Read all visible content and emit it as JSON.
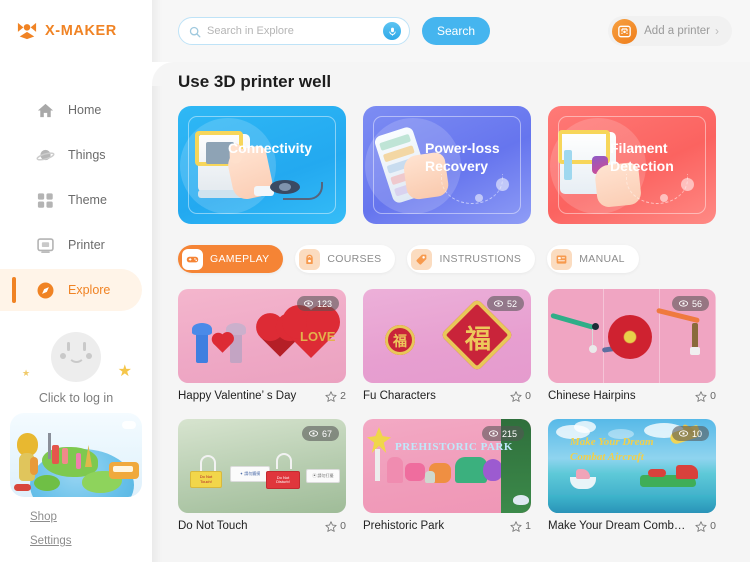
{
  "brand": {
    "name": "X-MAKER",
    "logo_icon": "x-maker-logo-icon",
    "color": "#f08324"
  },
  "search": {
    "placeholder": "Search in Explore",
    "value": "",
    "search_icon": "search-icon",
    "mic_icon": "microphone-icon",
    "button_label": "Search"
  },
  "add_printer": {
    "label": "Add a printer",
    "icon": "printer-add-icon",
    "chevron": "›"
  },
  "sidebar": {
    "items": [
      {
        "label": "Home",
        "icon": "home-icon",
        "active": false
      },
      {
        "label": "Things",
        "icon": "planet-icon",
        "active": false
      },
      {
        "label": "Theme",
        "icon": "grid-icon",
        "active": false
      },
      {
        "label": "Printer",
        "icon": "printer-icon",
        "active": false
      },
      {
        "label": "Explore",
        "icon": "compass-icon",
        "active": true
      }
    ],
    "login": {
      "text": "Click to log in",
      "avatar_icon": "smiley-avatar-icon"
    },
    "links": [
      {
        "label": "Shop"
      },
      {
        "label": "Settings"
      }
    ]
  },
  "main": {
    "title": "Use 3D printer well",
    "banners": [
      {
        "title": "Connectivity",
        "color": "#23a9f0"
      },
      {
        "title": "Power-loss\nRecovery",
        "color": "#6675ee"
      },
      {
        "title": "Filament Detection",
        "color": "#fb6360"
      }
    ],
    "banner_titles": {
      "b1": "Connectivity",
      "b2_line1": "Power-loss",
      "b2_line2": "Recovery",
      "b3": "Filament Detection"
    },
    "tabs": [
      {
        "label": "GAMEPLAY",
        "icon": "gamepad-icon",
        "active": true
      },
      {
        "label": "COURSES",
        "icon": "backpack-icon",
        "active": false
      },
      {
        "label": "INSTRUSTIONS",
        "icon": "tag-icon",
        "active": false
      },
      {
        "label": "MANUAL",
        "icon": "document-icon",
        "active": false
      }
    ],
    "cards": [
      {
        "title": "Happy Valentine’ s Day",
        "views": "123",
        "favorites": "2"
      },
      {
        "title": "Fu Characters",
        "views": "52",
        "favorites": "0"
      },
      {
        "title": "Chinese Hairpins",
        "views": "56",
        "favorites": "0"
      },
      {
        "title": "Do Not Touch",
        "views": "67",
        "favorites": "0"
      },
      {
        "title": "Prehistoric Park",
        "views": "215",
        "favorites": "1"
      },
      {
        "title": "Make Your Dream Combat A...",
        "views": "10",
        "favorites": "0"
      }
    ],
    "card_art": {
      "fu_char": "福",
      "valentine_word": "LOVE",
      "prehistoric_word": "PREHISTORIC PARK",
      "aircraft_line1": "Make Your Dream",
      "aircraft_line2": "Combat Aircraft"
    },
    "icons": {
      "eye": "eye-icon",
      "star": "star-outline-icon"
    }
  }
}
